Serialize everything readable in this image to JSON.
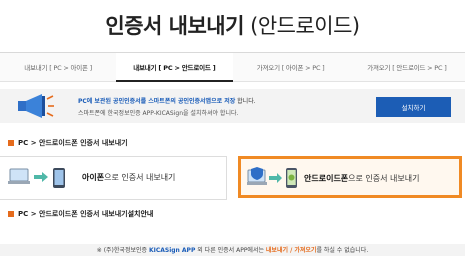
{
  "page_title": {
    "main": "인증서 내보내기",
    "sub": "(안드로이드)"
  },
  "tabs": [
    {
      "label": "내보내기 [ PC > 아이폰 ]",
      "active": false
    },
    {
      "label": "내보내기 [ PC > 안드로이드 ]",
      "active": true
    },
    {
      "label": "가져오기 [ 아이폰 > PC ]",
      "active": false
    },
    {
      "label": "가져오기 [ 안드로이드 > PC ]",
      "active": false
    }
  ],
  "notice": {
    "line1_prefix": "PC에 보관된 공인인증서를 스마트폰의 공인인증서앱으로 저장",
    "line1_suffix": " 합니다.",
    "line2": "스마트폰에 한국정보인증 APP-KICASign을 설치하셔야 합니다.",
    "install_label": "설치하기"
  },
  "section1": "PC > 안드로이드폰 인증서 내보내기",
  "cards": {
    "left": {
      "bold": "아이폰",
      "rest": "으로 인증서 내보내기"
    },
    "right": {
      "bold": "안드로이드폰",
      "rest": "으로 인증서 내보내기"
    }
  },
  "section2_prefix": "PC > 안드로이드폰 인증서 내보내기 ",
  "section2_bold": "설치안내",
  "footer": {
    "p1": "※ (주)한국정보인증 ",
    "brand": "KICASign APP",
    "p2": " 외 다른 인증서 APP에서는 ",
    "hl": "내보내기 / 가져오기",
    "p3": "를 하실 수 없습니다."
  },
  "colors": {
    "accent": "#e56b1c",
    "brand_blue": "#1c5db5",
    "highlight_border": "#f08a24"
  }
}
